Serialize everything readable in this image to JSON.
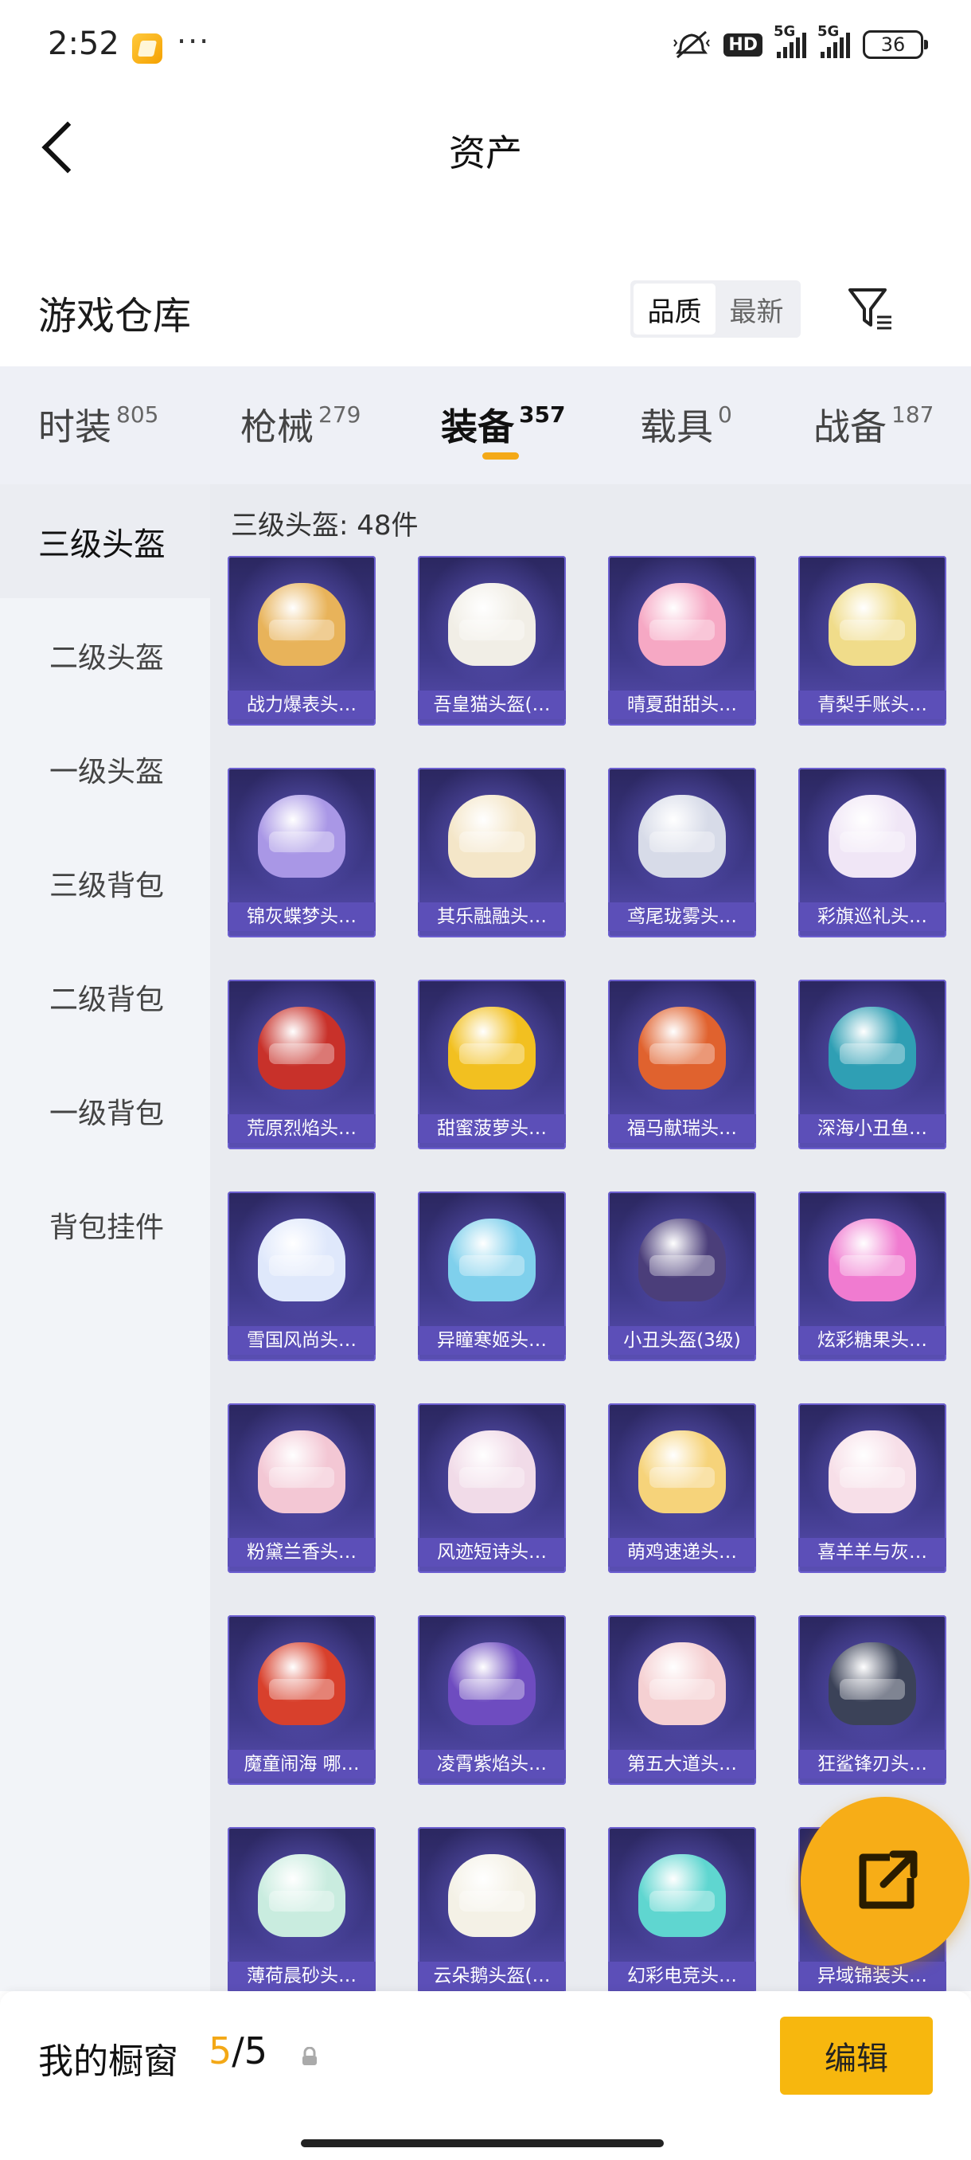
{
  "status_bar": {
    "time": "2:52",
    "dots": "···",
    "hd": "HD",
    "net1": "5G",
    "net2": "5G",
    "battery": "36"
  },
  "header": {
    "title": "资产"
  },
  "warehouse": {
    "title": "游戏仓库",
    "sort_options": [
      "品质",
      "最新"
    ],
    "sort_selected": "品质"
  },
  "tabs": [
    {
      "label": "时装",
      "count": "805"
    },
    {
      "label": "枪械",
      "count": "279"
    },
    {
      "label": "装备",
      "count": "357",
      "active": true
    },
    {
      "label": "载具",
      "count": "0"
    },
    {
      "label": "战备",
      "count": "187"
    }
  ],
  "sidebar": {
    "items": [
      "三级头盔",
      "二级头盔",
      "一级头盔",
      "三级背包",
      "二级背包",
      "一级背包",
      "背包挂件"
    ],
    "active": "三级头盔"
  },
  "main": {
    "section_title": "三级头盔: 48件",
    "items": [
      {
        "name": "战力爆表头…",
        "color": "#e8b35a"
      },
      {
        "name": "吾皇猫头盔(…",
        "color": "#f1eee6"
      },
      {
        "name": "晴夏甜甜头…",
        "color": "#f6a8c4"
      },
      {
        "name": "青梨手账头…",
        "color": "#f0dc8a"
      },
      {
        "name": "锦灰蝶梦头…",
        "color": "#a997e6"
      },
      {
        "name": "其乐融融头…",
        "color": "#f4e6c8"
      },
      {
        "name": "鸢尾珑雾头…",
        "color": "#d7dbe8"
      },
      {
        "name": "彩旗巡礼头…",
        "color": "#f0e6f6"
      },
      {
        "name": "荒原烈焰头…",
        "color": "#c8312a"
      },
      {
        "name": "甜蜜菠萝头…",
        "color": "#f2c020"
      },
      {
        "name": "福马献瑞头…",
        "color": "#e0622e"
      },
      {
        "name": "深海小丑鱼…",
        "color": "#2f9fb4"
      },
      {
        "name": "雪国风尚头…",
        "color": "#dfe8fb"
      },
      {
        "name": "异瞳寒姬头…",
        "color": "#7fd0ec"
      },
      {
        "name": "小丑头盔(3级)",
        "color": "#4b3e7a"
      },
      {
        "name": "炫彩糖果头…",
        "color": "#f07bd0"
      },
      {
        "name": "粉黛兰香头…",
        "color": "#f3c7d4"
      },
      {
        "name": "风迹短诗头…",
        "color": "#f1dbe8"
      },
      {
        "name": "萌鸡速递头…",
        "color": "#f6d37a"
      },
      {
        "name": "喜羊羊与灰…",
        "color": "#f7dfe8"
      },
      {
        "name": "魔童闹海 哪…",
        "color": "#d8402c"
      },
      {
        "name": "凌霄紫焰头…",
        "color": "#6e4cc0"
      },
      {
        "name": "第五大道头…",
        "color": "#f5d0d2"
      },
      {
        "name": "狂鲨锋刃头…",
        "color": "#3b4258"
      },
      {
        "name": "薄荷晨砂头…",
        "color": "#c9ecdf"
      },
      {
        "name": "云朵鹅头盔(…",
        "color": "#f4f1e6"
      },
      {
        "name": "幻彩电竞头…",
        "color": "#5fd6d0"
      },
      {
        "name": "异域锦装头…",
        "color": "#4a4c68"
      }
    ]
  },
  "bottom": {
    "label": "我的橱窗",
    "current": "5",
    "separator": "/",
    "total": "5",
    "edit": "编辑"
  },
  "accent": "#f7b70e"
}
